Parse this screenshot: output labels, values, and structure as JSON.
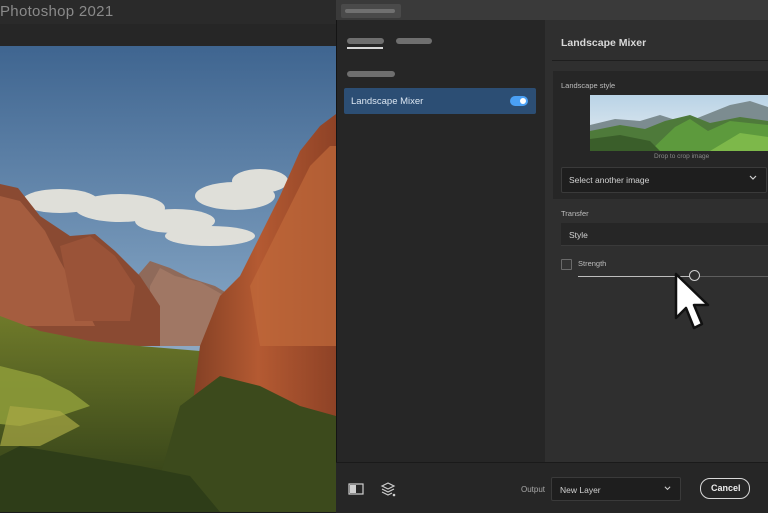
{
  "app": {
    "title": "Photoshop 2021"
  },
  "dialog": {
    "filters": [
      {
        "label": "Landscape Mixer",
        "enabled": true
      }
    ],
    "panel": {
      "title": "Landscape Mixer",
      "landscape_style": {
        "label": "Landscape style",
        "drop_hint": "Drop to crop image",
        "select_button": "Select another image"
      },
      "transfer": {
        "label": "Transfer",
        "value": "Style"
      },
      "strength": {
        "label": "Strength",
        "checked": false,
        "value_fraction": 0.61
      }
    },
    "footer": {
      "output_label": "Output",
      "output_value": "New Layer",
      "cancel_label": "Cancel"
    }
  },
  "colors": {
    "accent": "#4aa0f5",
    "selection": "#2c4e74",
    "panel_bg": "#2f2f2f",
    "sidebar_bg": "#262626"
  },
  "icons": {
    "toggle": "toggle-switch",
    "select_chevron": "chevron-down-icon",
    "compare": "compare-view-icon",
    "layers": "layers-icon",
    "cursor": "mouse-pointer-icon"
  }
}
